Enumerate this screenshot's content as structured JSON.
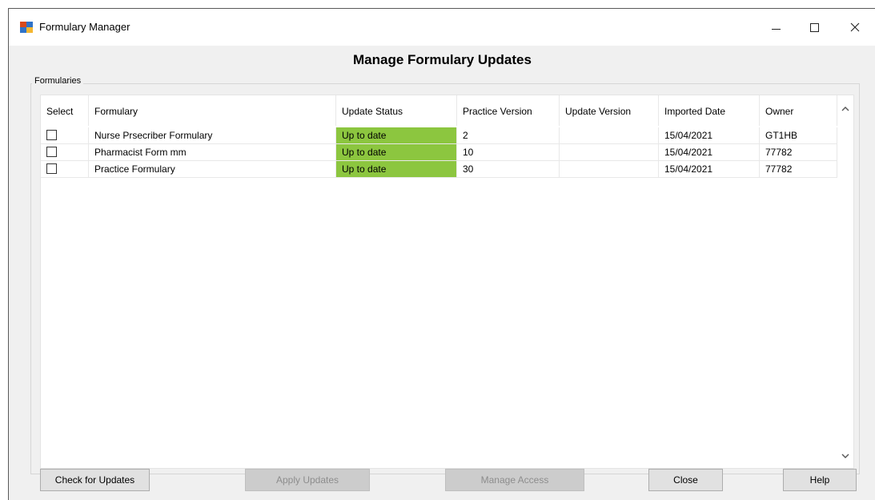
{
  "window": {
    "title": "Formulary Manager",
    "icon": "formulary-app-icon"
  },
  "heading": "Manage Formulary Updates",
  "group_label": "Formularies",
  "columns": [
    "Select",
    "Formulary",
    "Update Status",
    "Practice Version",
    "Update Version",
    "Imported Date",
    "Owner"
  ],
  "rows": [
    {
      "selected": false,
      "formulary": "Nurse Prsecriber Formulary",
      "status": "Up to date",
      "practice_version": "2",
      "update_version": "",
      "imported_date": "15/04/2021",
      "owner": "GT1HB"
    },
    {
      "selected": false,
      "formulary": "Pharmacist Form mm",
      "status": "Up to date",
      "practice_version": "10",
      "update_version": "",
      "imported_date": "15/04/2021",
      "owner": "77782"
    },
    {
      "selected": false,
      "formulary": "Practice Formulary",
      "status": "Up to date",
      "practice_version": "30",
      "update_version": "",
      "imported_date": "15/04/2021",
      "owner": "77782"
    }
  ],
  "buttons": {
    "check_updates": "Check for Updates",
    "apply_updates": "Apply Updates",
    "manage_access": "Manage Access",
    "close": "Close",
    "help": "Help"
  },
  "colors": {
    "status_up_to_date": "#8cc63f"
  }
}
